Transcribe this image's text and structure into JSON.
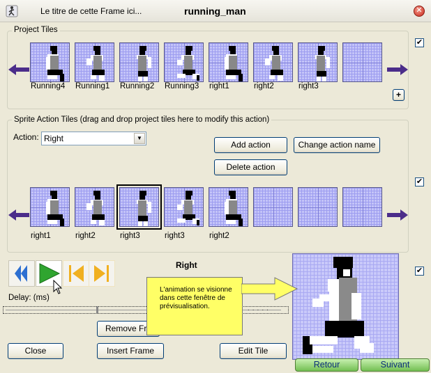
{
  "window": {
    "title_left": "Le titre de cette Frame ici...",
    "title_main": "running_man",
    "close_glyph": "✕"
  },
  "project_tiles": {
    "label": "Project Tiles",
    "tiles": [
      {
        "label": "Running4",
        "empty": false
      },
      {
        "label": "Running1",
        "empty": false
      },
      {
        "label": "Running2",
        "empty": false
      },
      {
        "label": "Running3",
        "empty": false
      },
      {
        "label": "right1",
        "empty": false
      },
      {
        "label": "right2",
        "empty": false
      },
      {
        "label": "right3",
        "empty": false
      },
      {
        "label": "",
        "empty": true
      }
    ],
    "add_label": "+",
    "checked": true
  },
  "sprite_action": {
    "label": "Sprite Action Tiles (drag and drop project tiles here to modify this action)",
    "action_label": "Action:",
    "action_value": "Right",
    "add_action": "Add action",
    "change_action_name": "Change action name",
    "delete_action": "Delete action",
    "tiles": [
      {
        "label": "right1",
        "empty": false,
        "selected": false
      },
      {
        "label": "right2",
        "empty": false,
        "selected": false
      },
      {
        "label": "right3",
        "empty": false,
        "selected": true
      },
      {
        "label": "right3",
        "empty": false,
        "selected": false
      },
      {
        "label": "right2",
        "empty": false,
        "selected": false
      },
      {
        "label": "",
        "empty": true,
        "selected": false
      },
      {
        "label": "",
        "empty": true,
        "selected": false
      },
      {
        "label": "",
        "empty": true,
        "selected": false
      }
    ],
    "checked": true
  },
  "animation": {
    "current_action": "Right",
    "delay_label": "Delay: (ms)",
    "remove_frame": "Remove Frame",
    "insert_frame": "Insert Frame",
    "edit_tile": "Edit Tile",
    "close": "Close",
    "checked": true
  },
  "callout": {
    "text": "L'animation se visionne dans cette fenêtre de prévisualisation."
  },
  "nav": {
    "back": "Retour",
    "next": "Suivant"
  },
  "colors": {
    "arrow": "#4b2d8a",
    "play": "#2fa52f",
    "rewind": "#2d6fd1",
    "step": "#f0b020",
    "callout": "#ffff66"
  }
}
